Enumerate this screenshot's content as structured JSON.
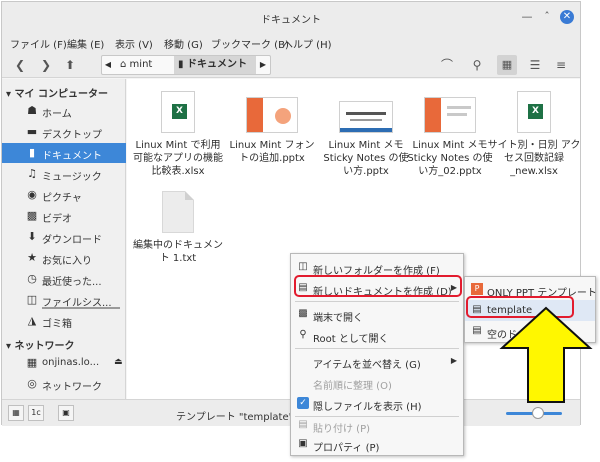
{
  "window": {
    "title": "ドキュメント"
  },
  "menubar": [
    "ファイル (F)",
    "編集 (E)",
    "表示 (V)",
    "移動 (G)",
    "ブックマーク (B)",
    "ヘルプ (H)"
  ],
  "breadcrumbs": [
    "mint",
    "ドキュメント"
  ],
  "sidebar": {
    "computer_header": "マイ コンピューター",
    "computer_items": [
      {
        "icon": "home-icon",
        "label": "ホーム"
      },
      {
        "icon": "desktop-icon",
        "label": "デスクトップ"
      },
      {
        "icon": "document-icon",
        "label": "ドキュメント"
      },
      {
        "icon": "music-icon",
        "label": "ミュージック"
      },
      {
        "icon": "camera-icon",
        "label": "ピクチャ"
      },
      {
        "icon": "film-icon",
        "label": "ビデオ"
      },
      {
        "icon": "download-icon",
        "label": "ダウンロード"
      },
      {
        "icon": "star-icon",
        "label": "お気に入り"
      },
      {
        "icon": "clock-icon",
        "label": "最近使った..."
      },
      {
        "icon": "filesystem-icon",
        "label": "ファイルシス..."
      },
      {
        "icon": "trash-icon",
        "label": "ゴミ箱"
      }
    ],
    "network_header": "ネットワーク",
    "network_items": [
      {
        "icon": "share-icon",
        "label": "onjinas.lo..."
      },
      {
        "icon": "network-icon",
        "label": "ネットワーク"
      }
    ]
  },
  "files": [
    {
      "type": "xlsx",
      "name": "Linux Mint で利用可能なアプリの機能比較表.xlsx"
    },
    {
      "type": "pptx",
      "name": "Linux Mint フォントの追加.pptx"
    },
    {
      "type": "pptx-sticky",
      "name": "Linux Mint メモ Sticky Notes の使い方.pptx"
    },
    {
      "type": "pptx",
      "name": "Linux Mint メモ Sticky Notes の使い方_02.pptx"
    },
    {
      "type": "xlsx",
      "name": "サイト別・日別 アクセス回数記録_new.xlsx"
    },
    {
      "type": "txt",
      "name": "編集中のドキュメント 1.txt"
    }
  ],
  "context_menu": [
    {
      "icon": "new-folder-icon",
      "label": "新しいフォルダーを作成 (F)",
      "disabled": false
    },
    {
      "icon": "new-doc-icon",
      "label": "新しいドキュメントを作成 (D)",
      "disabled": false,
      "submenu": true
    },
    {
      "icon": "terminal-icon",
      "label": "端末で開く",
      "disabled": false
    },
    {
      "icon": "key-icon",
      "label": "Root として開く",
      "disabled": false
    },
    {
      "icon": "",
      "label": "アイテムを並べ替え (G)",
      "disabled": false,
      "submenu": true
    },
    {
      "icon": "",
      "label": "名前順に整理 (O)",
      "disabled": true
    },
    {
      "icon": "check-icon",
      "label": "隠しファイルを表示 (H)",
      "disabled": false
    },
    {
      "icon": "paste-icon",
      "label": "貼り付け (P)",
      "disabled": true
    },
    {
      "icon": "properties-icon",
      "label": "プロパティ (P)",
      "disabled": false
    }
  ],
  "submenu": [
    {
      "label": "ONLY PPT テンプレート"
    },
    {
      "label": "template"
    },
    {
      "label": "空のドキュメント"
    }
  ],
  "statusbar": {
    "text": "テンプレート \"template\" から新"
  },
  "colors": {
    "accent": "#3d87d8",
    "highlight": "#e21b2e",
    "arrow_fill": "#fff700",
    "excel_green": "#1e7145",
    "ppt_orange": "#e8693a"
  }
}
